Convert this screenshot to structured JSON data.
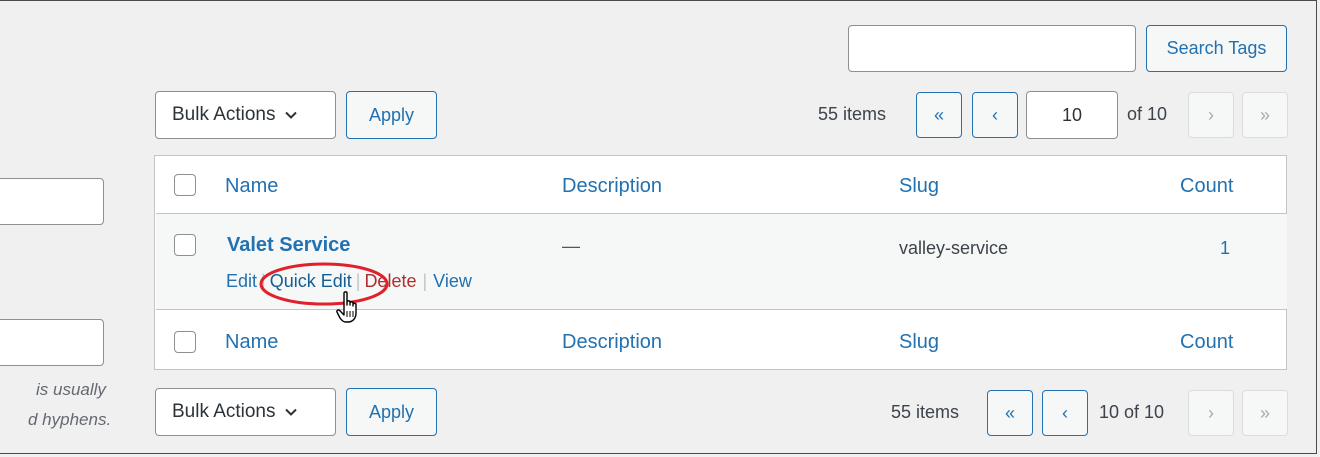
{
  "search": {
    "value": "",
    "button_label": "Search Tags"
  },
  "top_nav": {
    "bulk_actions": "Bulk Actions",
    "apply_label": "Apply",
    "items_count": "55 items",
    "first_page": "«",
    "prev_page": "‹",
    "current_page": "10",
    "of_pages": "of 10",
    "next_page": "›",
    "last_page": "»"
  },
  "table": {
    "columns": [
      "Name",
      "Description",
      "Slug",
      "Count"
    ],
    "rows": [
      {
        "name": "Valet Service",
        "description": "—",
        "slug": "valley-service",
        "count": "1",
        "actions": {
          "edit": "Edit",
          "quick_edit": "Quick Edit",
          "delete": "Delete",
          "view": "View",
          "separator": "|"
        }
      }
    ]
  },
  "bottom_nav": {
    "bulk_actions": "Bulk Actions",
    "apply_label": "Apply",
    "items_count": "55 items",
    "first_page": "«",
    "prev_page": "‹",
    "page_text": "10 of 10",
    "next_page": "›",
    "last_page": "»"
  },
  "left_panel": {
    "help_line1": "is usually",
    "help_line2": "d hyphens."
  },
  "colors": {
    "link": "#2271b1",
    "delete": "#b32d2e",
    "highlight_circle": "#e0202a",
    "background": "#f0f0f1"
  }
}
